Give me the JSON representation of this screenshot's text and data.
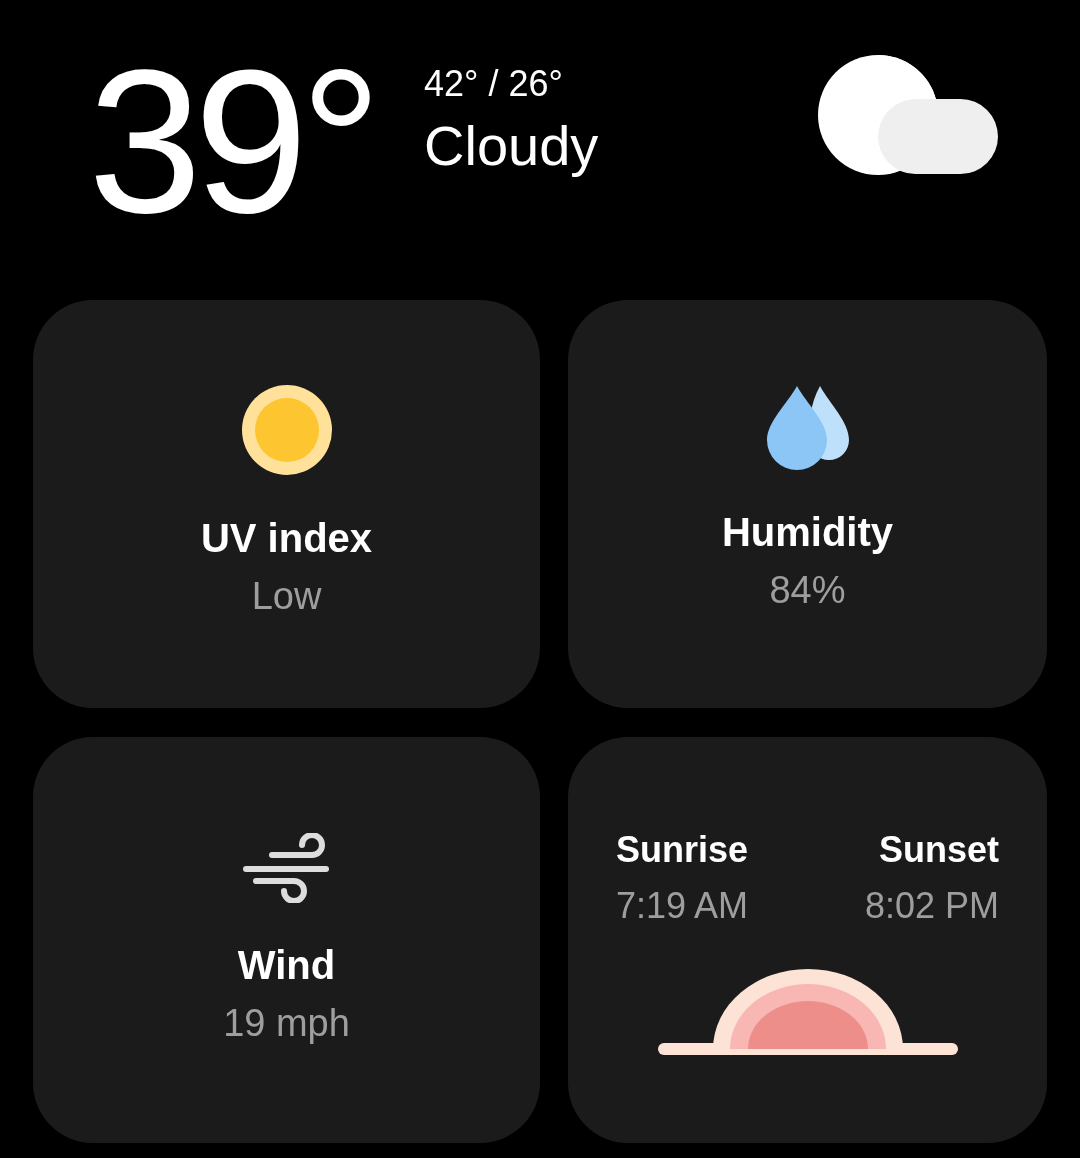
{
  "current": {
    "temperature": "39°",
    "high_low": "42° / 26°",
    "condition": "Cloudy"
  },
  "cards": [
    {
      "kind": "uv",
      "title": "UV index",
      "value": "Low"
    },
    {
      "kind": "humidity",
      "title": "Humidity",
      "value": "84%"
    },
    {
      "kind": "wind",
      "title": "Wind",
      "value": "19 mph"
    }
  ],
  "sun_card": {
    "sunrise_label": "Sunrise",
    "sunrise_time": "7:19 AM",
    "sunset_label": "Sunset",
    "sunset_time": "8:02 PM"
  }
}
